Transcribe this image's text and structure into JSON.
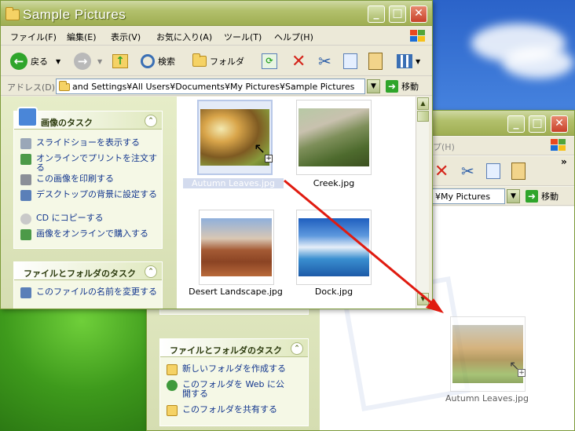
{
  "front_window": {
    "title": "Sample Pictures",
    "menu": [
      "ファイル(F)",
      "編集(E)",
      "表示(V)",
      "お気に入り(A)",
      "ツール(T)",
      "ヘルプ(H)"
    ],
    "toolbar": {
      "back_label": "戻る",
      "search_label": "検索",
      "folders_label": "フォルダ"
    },
    "address": {
      "label": "アドレス(D)",
      "value": "and Settings¥All Users¥Documents¥My Pictures¥Sample Pictures",
      "go_label": "移動"
    },
    "picture_tasks": {
      "title": "画像のタスク",
      "items": [
        "スライドショーを表示する",
        "オンラインでプリントを注文する",
        "この画像を印刷する",
        "デスクトップの背景に設定する",
        "CD にコピーする",
        "画像をオンラインで購入する"
      ]
    },
    "file_tasks": {
      "title": "ファイルとフォルダのタスク",
      "items": [
        "このファイルの名前を変更する"
      ]
    },
    "files": [
      {
        "name": "Autumn Leaves.jpg",
        "selected": true
      },
      {
        "name": "Creek.jpg"
      },
      {
        "name": "Desert Landscape.jpg"
      },
      {
        "name": "Dock.jpg"
      }
    ]
  },
  "back_window": {
    "menu_fragment": "プ(H)",
    "address_fragment": "¥My Pictures",
    "go_label": "移動",
    "file_tasks": {
      "title": "ファイルとフォルダのタスク",
      "items": [
        "新しいフォルダを作成する",
        "このフォルダを Web に公開する",
        "このフォルダを共有する"
      ]
    },
    "dragged_file": "Autumn Leaves.jpg"
  },
  "colors": {
    "title_bar": "#9fae52",
    "task_link": "#12368e",
    "drag_arrow": "#e01b10"
  }
}
